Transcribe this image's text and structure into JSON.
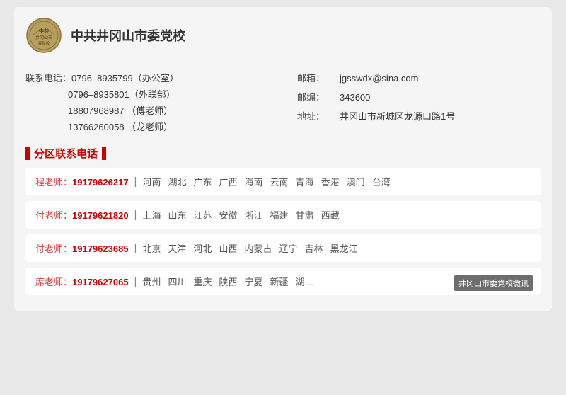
{
  "org": {
    "name": "中共井冈山市委党校",
    "logo_alt": "党校logo"
  },
  "contact": {
    "phone_label": "联系电话：",
    "phone1": "0796–8935799（办公室）",
    "phone2": "0796–8935801（外联部）",
    "phone3": "18807968987 （傅老师）",
    "phone4": "13766260058 （龙老师）",
    "email_label": "邮箱：",
    "email_value": "jgsswdx@sina.com",
    "postcode_label": "邮编：",
    "postcode_value": "343600",
    "address_label": "地址：",
    "address_value": "井冈山市新城区龙源口路1号"
  },
  "section_title": "分区联系电话",
  "regions": [
    {
      "teacher": "程老师：",
      "phone": "19179626217",
      "areas": [
        "河南",
        "湖北",
        "广东",
        "广西",
        "海南",
        "云南",
        "青海",
        "香港",
        "澳门",
        "台湾"
      ]
    },
    {
      "teacher": "付老师：",
      "phone": "19179621820",
      "areas": [
        "上海",
        "山东",
        "江苏",
        "安徽",
        "浙江",
        "福建",
        "甘肃",
        "西藏"
      ]
    },
    {
      "teacher": "付老师：",
      "phone": "19179623685",
      "areas": [
        "北京",
        "天津",
        "河北",
        "山西",
        "内蒙古",
        "辽宁",
        "吉林",
        "黑龙江"
      ]
    },
    {
      "teacher": "席老师：",
      "phone": "19179627065",
      "areas": [
        "贵州",
        "四川",
        "重庆",
        "陕西",
        "宁夏",
        "新疆",
        "湖…"
      ]
    }
  ],
  "watermark": "井冈山市委党校微讯"
}
